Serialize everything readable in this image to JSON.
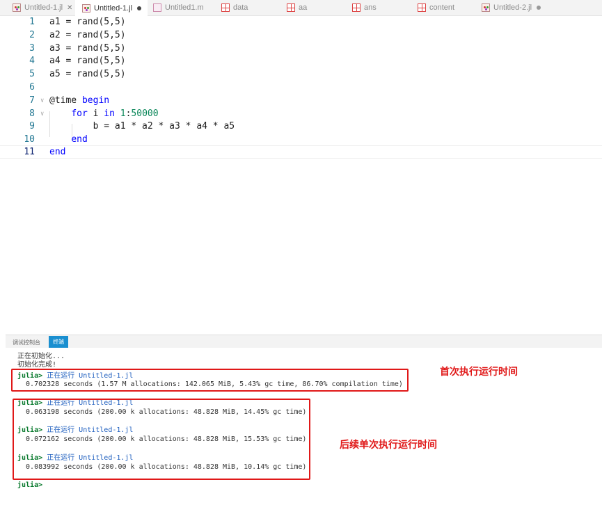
{
  "tabs": [
    {
      "label": "Untitled-1.jl",
      "icon": "julia-file-icon",
      "state": "close",
      "active": false
    },
    {
      "label": "Untitled-1.jl",
      "icon": "julia-file-icon",
      "state": "modified",
      "active": true
    },
    {
      "label": "Untitled1.m",
      "icon": "matlab-file-icon",
      "state": "none",
      "active": false
    },
    {
      "label": "data",
      "icon": "table-icon",
      "state": "none",
      "active": false
    },
    {
      "label": "aa",
      "icon": "table-icon",
      "state": "none",
      "active": false
    },
    {
      "label": "ans",
      "icon": "table-icon",
      "state": "none",
      "active": false
    },
    {
      "label": "content",
      "icon": "table-icon",
      "state": "none",
      "active": false
    },
    {
      "label": "Untitled-2.jl",
      "icon": "julia-file-icon",
      "state": "modified",
      "active": false
    }
  ],
  "editor": {
    "line_numbers": [
      "1",
      "2",
      "3",
      "4",
      "5",
      "6",
      "7",
      "8",
      "9",
      "10",
      "11"
    ],
    "lines": {
      "l1": "a1 = rand(5,5)",
      "l2": "a2 = rand(5,5)",
      "l3": "a3 = rand(5,5)",
      "l4": "a4 = rand(5,5)",
      "l5": "a5 = rand(5,5)",
      "l7_macro": "@time ",
      "l7_kw": "begin",
      "l8_indent": "    ",
      "l8_for": "for",
      "l8_mid": " i ",
      "l8_in": "in",
      "l8_range_start": " 1",
      "l8_colon": ":",
      "l8_range_end": "50000",
      "l9": "        b = a1 * a2 * a3 * a4 * a5",
      "l10_indent": "    ",
      "l10_end": "end",
      "l11_end": "end"
    }
  },
  "panel": {
    "tabs": [
      "调试控制台",
      "终端"
    ],
    "active_tab": "终端"
  },
  "terminal": {
    "init1": "正在初始化...",
    "init2": "初始化完成!",
    "prompt": "julia>",
    "running": "正在运行 Untitled-1.jl",
    "out1": "  0.702328 seconds (1.57 M allocations: 142.065 MiB, 5.43% gc time, 86.70% compilation time)",
    "out2": "  0.063198 seconds (200.00 k allocations: 48.828 MiB, 14.45% gc time)",
    "out3": "  0.072162 seconds (200.00 k allocations: 48.828 MiB, 15.53% gc time)",
    "out4": "  0.083992 seconds (200.00 k allocations: 48.828 MiB, 10.14% gc time)"
  },
  "annotations": {
    "first_run": "首次执行运行时间",
    "subsequent_runs": "后续单次执行运行时间",
    "color": "#e01818"
  }
}
